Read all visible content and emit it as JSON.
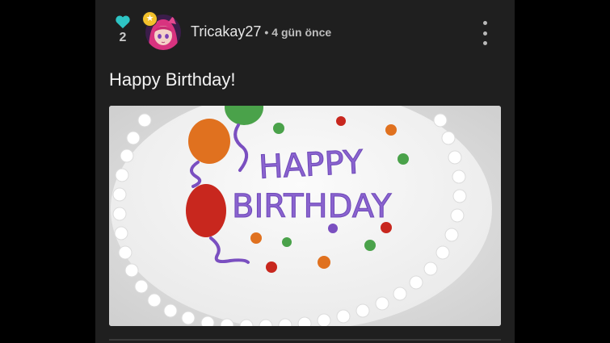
{
  "post": {
    "likes": "2",
    "author": "Tricakay27",
    "separator": "•",
    "time_ago": "4 gün önce",
    "text": "Happy Birthday!"
  },
  "image": {
    "cake_text_line1": "HAPPY",
    "cake_text_line2": "BIRTHDAY"
  },
  "colors": {
    "background": "#000000",
    "panel": "#1f1f1f",
    "like_heart": "#2ec4c4",
    "badge": "#f3c12b"
  },
  "icons": {
    "like": "heart-icon",
    "badge": "star-icon",
    "menu": "more-vertical-icon"
  }
}
